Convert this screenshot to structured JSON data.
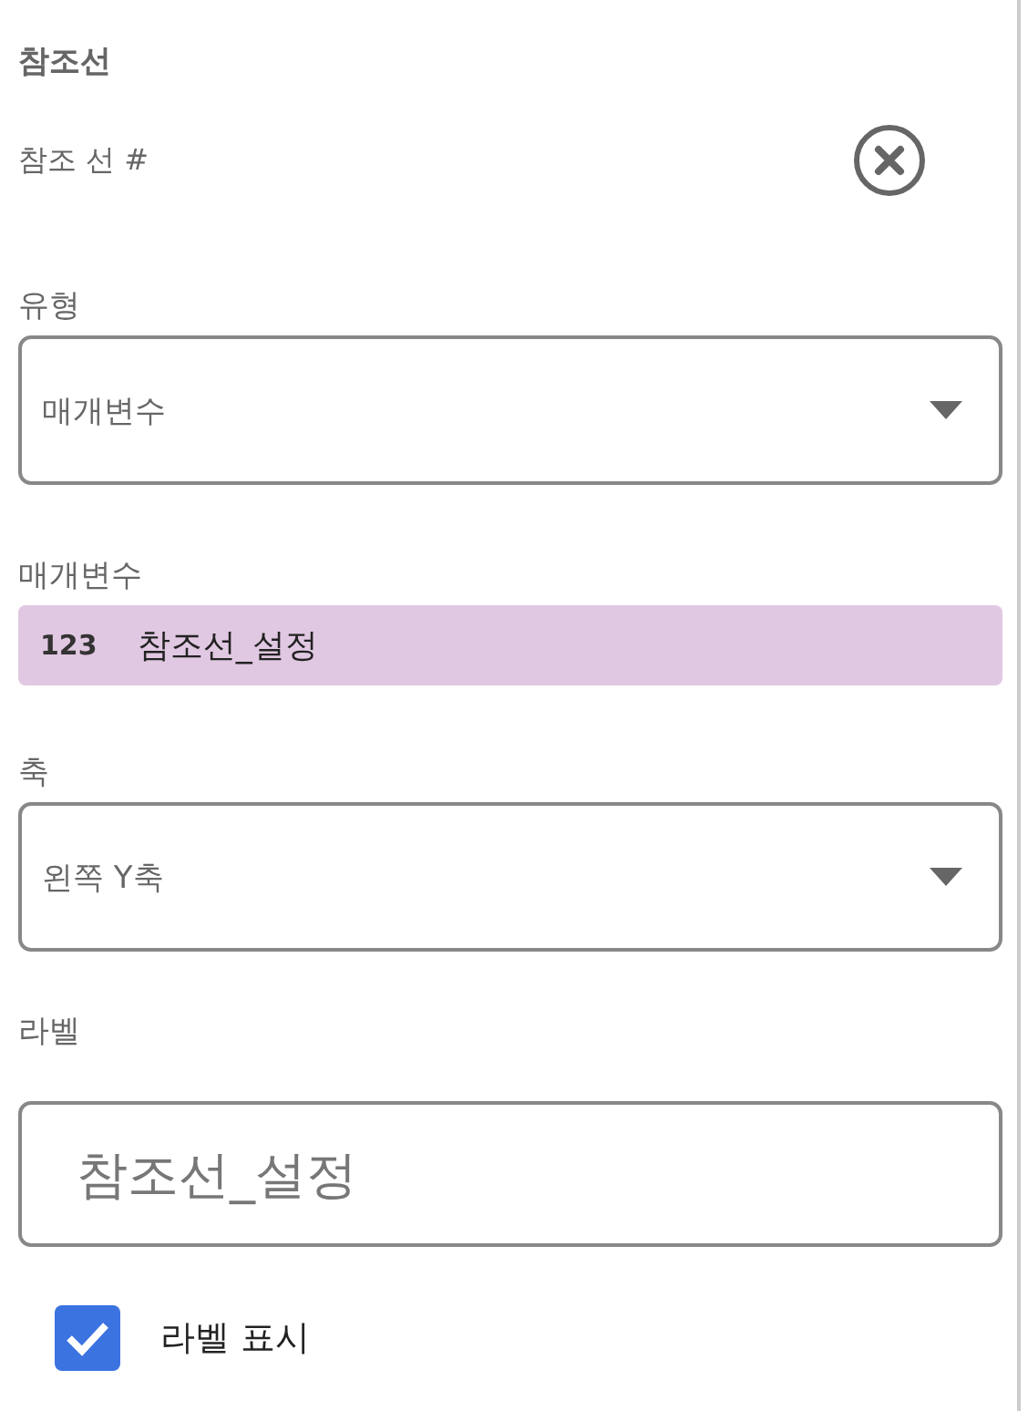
{
  "section_title": "참조선",
  "reference_line": {
    "label": "참조 선 #"
  },
  "type_field": {
    "label": "유형",
    "value": "매개변수"
  },
  "parameter_field": {
    "label": "매개변수",
    "type_badge": "123",
    "value": "참조선_설정"
  },
  "axis_field": {
    "label": "축",
    "value": "왼쪽 Y축"
  },
  "label_field": {
    "label": "라벨",
    "placeholder": "참조선_설정"
  },
  "show_label": {
    "label": "라벨 표시",
    "checked": true
  }
}
